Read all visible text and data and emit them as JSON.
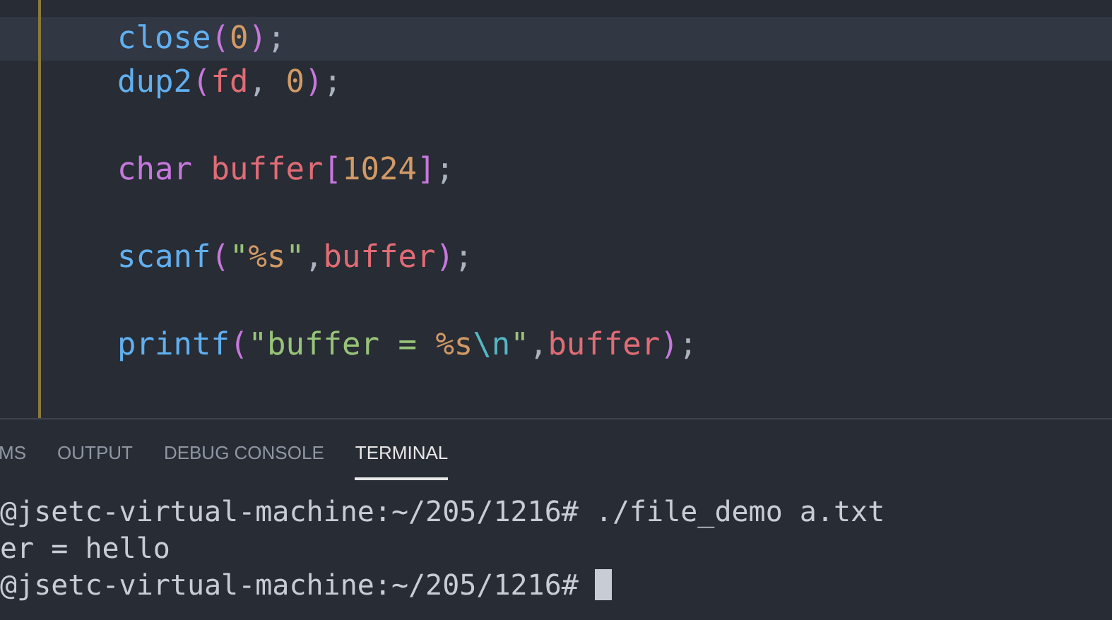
{
  "editor": {
    "lines": [
      {
        "kind": "code",
        "current": true,
        "tokens": [
          {
            "text": "close",
            "kind": "function"
          },
          {
            "text": "(",
            "kind": "bracket"
          },
          {
            "text": "0",
            "kind": "number"
          },
          {
            "text": ")",
            "kind": "bracket"
          },
          {
            "text": ";",
            "kind": "punct"
          }
        ]
      },
      {
        "kind": "code",
        "current": false,
        "tokens": [
          {
            "text": "dup2",
            "kind": "function"
          },
          {
            "text": "(",
            "kind": "bracket"
          },
          {
            "text": "fd",
            "kind": "variable"
          },
          {
            "text": ", ",
            "kind": "punct"
          },
          {
            "text": "0",
            "kind": "number"
          },
          {
            "text": ")",
            "kind": "bracket"
          },
          {
            "text": ";",
            "kind": "punct"
          }
        ]
      },
      {
        "kind": "blank",
        "current": false
      },
      {
        "kind": "code",
        "current": false,
        "tokens": [
          {
            "text": "char ",
            "kind": "keyword"
          },
          {
            "text": "buffer",
            "kind": "variable"
          },
          {
            "text": "[",
            "kind": "bracket"
          },
          {
            "text": "1024",
            "kind": "number"
          },
          {
            "text": "]",
            "kind": "bracket"
          },
          {
            "text": ";",
            "kind": "punct"
          }
        ]
      },
      {
        "kind": "blank",
        "current": false
      },
      {
        "kind": "code",
        "current": false,
        "tokens": [
          {
            "text": "scanf",
            "kind": "function"
          },
          {
            "text": "(",
            "kind": "bracket"
          },
          {
            "text": "\"",
            "kind": "string"
          },
          {
            "text": "%s",
            "kind": "format"
          },
          {
            "text": "\"",
            "kind": "string"
          },
          {
            "text": ",",
            "kind": "punct"
          },
          {
            "text": "buffer",
            "kind": "variable"
          },
          {
            "text": ")",
            "kind": "bracket"
          },
          {
            "text": ";",
            "kind": "punct"
          }
        ]
      },
      {
        "kind": "blank",
        "current": false
      },
      {
        "kind": "code",
        "current": false,
        "tokens": [
          {
            "text": "printf",
            "kind": "function"
          },
          {
            "text": "(",
            "kind": "bracket"
          },
          {
            "text": "\"buffer = ",
            "kind": "string"
          },
          {
            "text": "%s",
            "kind": "format"
          },
          {
            "text": "\\n",
            "kind": "escape"
          },
          {
            "text": "\"",
            "kind": "string"
          },
          {
            "text": ",",
            "kind": "punct"
          },
          {
            "text": "buffer",
            "kind": "variable"
          },
          {
            "text": ")",
            "kind": "bracket"
          },
          {
            "text": ";",
            "kind": "punct"
          }
        ]
      },
      {
        "kind": "blank",
        "current": false
      }
    ]
  },
  "panel": {
    "tabs": [
      {
        "label": "MS",
        "selected": false
      },
      {
        "label": "OUTPUT",
        "selected": false
      },
      {
        "label": "DEBUG CONSOLE",
        "selected": false
      },
      {
        "label": "TERMINAL",
        "selected": true
      }
    ],
    "terminal": {
      "lines": [
        {
          "text": "@jsetc-virtual-machine:~/205/1216# ./file_demo a.txt",
          "cursor": false
        },
        {
          "text": "er = hello",
          "cursor": false
        },
        {
          "text": "@jsetc-virtual-machine:~/205/1216# ",
          "cursor": true
        }
      ]
    }
  }
}
